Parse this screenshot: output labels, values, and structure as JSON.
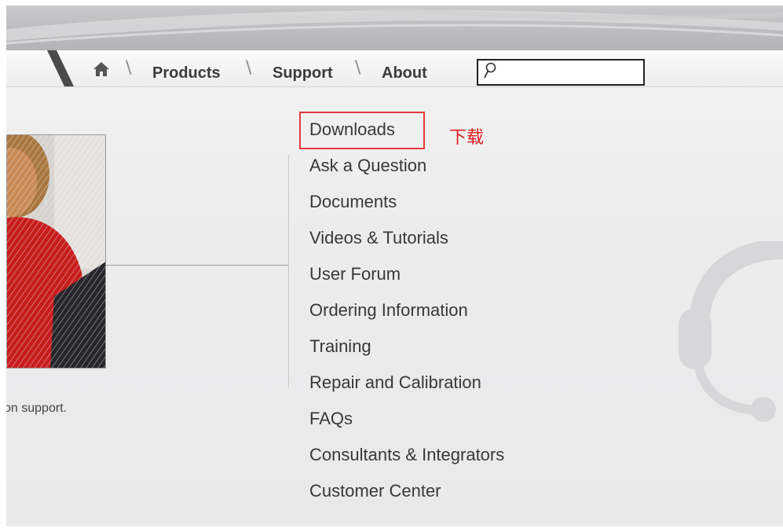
{
  "nav": {
    "home_icon": "home-icon",
    "items": [
      {
        "label": "Products"
      },
      {
        "label": "Support"
      },
      {
        "label": "About"
      }
    ],
    "separator": "\\",
    "search": {
      "icon": "search-icon",
      "placeholder": "",
      "value": ""
    }
  },
  "hero": {
    "caption": "on support."
  },
  "support_menu": {
    "items": [
      {
        "label": "Downloads"
      },
      {
        "label": "Ask a Question"
      },
      {
        "label": "Documents"
      },
      {
        "label": "Videos & Tutorials"
      },
      {
        "label": "User Forum"
      },
      {
        "label": "Ordering Information"
      },
      {
        "label": "Training"
      },
      {
        "label": "Repair and Calibration"
      },
      {
        "label": "FAQs"
      },
      {
        "label": "Consultants & Integrators"
      },
      {
        "label": "Customer Center"
      }
    ]
  },
  "annotation": {
    "text": "下载",
    "color": "#e0201f"
  },
  "colors": {
    "highlight_border": "#e23a3a",
    "nav_text": "#3b3b3b",
    "menu_text": "#383838"
  }
}
